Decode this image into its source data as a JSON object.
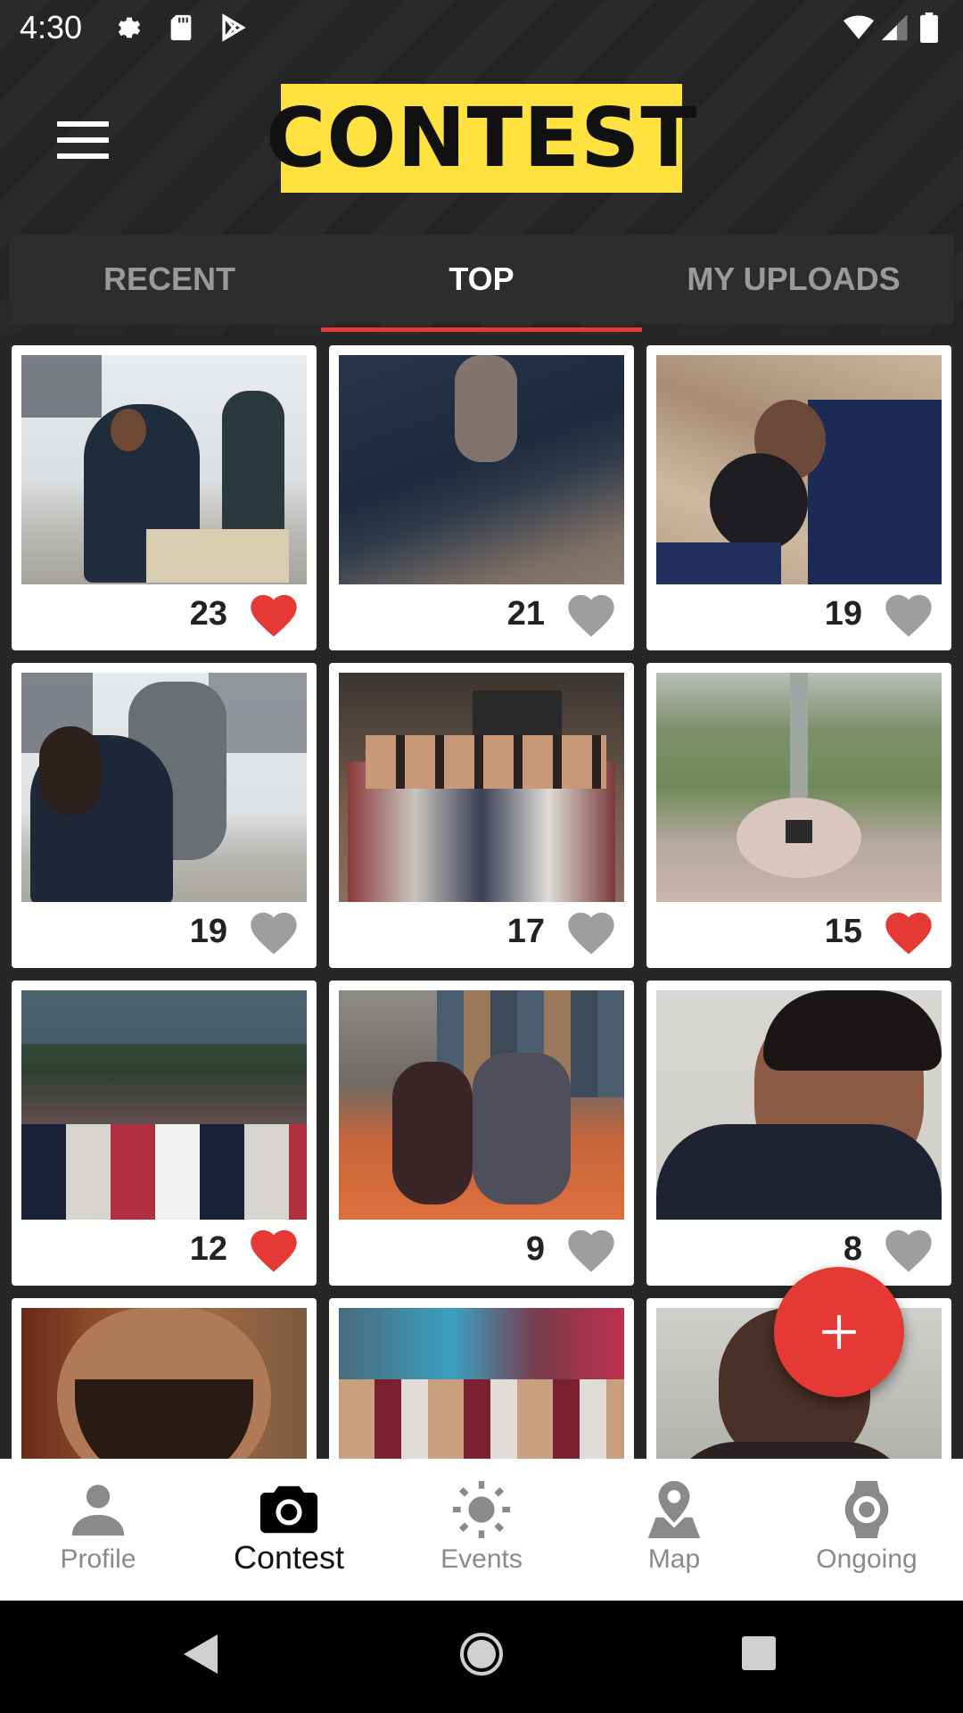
{
  "status_bar": {
    "time": "4:30",
    "icons": [
      "settings-icon",
      "sd-card-icon",
      "play-store-icon",
      "wifi-icon",
      "signal-icon",
      "battery-icon"
    ]
  },
  "header": {
    "title": "CONTEST",
    "title_bg": "#ffe23f",
    "menu_icon": "hamburger-icon"
  },
  "tabs": [
    {
      "label": "RECENT",
      "active": false
    },
    {
      "label": "TOP",
      "active": true
    },
    {
      "label": "MY UPLOADS",
      "active": false
    }
  ],
  "accent_color": "#e53935",
  "posts": [
    {
      "count": "23",
      "liked": true
    },
    {
      "count": "21",
      "liked": false
    },
    {
      "count": "19",
      "liked": false
    },
    {
      "count": "19",
      "liked": false
    },
    {
      "count": "17",
      "liked": false
    },
    {
      "count": "15",
      "liked": true
    },
    {
      "count": "12",
      "liked": true
    },
    {
      "count": "9",
      "liked": false
    },
    {
      "count": "8",
      "liked": false
    },
    {
      "count": "",
      "liked": false
    },
    {
      "count": "",
      "liked": false
    },
    {
      "count": "",
      "liked": false
    }
  ],
  "fab": {
    "icon": "plus-icon"
  },
  "bottom_nav": [
    {
      "label": "Profile",
      "icon": "person-icon",
      "active": false
    },
    {
      "label": "Contest",
      "icon": "camera-icon",
      "active": true
    },
    {
      "label": "Events",
      "icon": "sun-icon",
      "active": false
    },
    {
      "label": "Map",
      "icon": "map-pin-icon",
      "active": false
    },
    {
      "label": "Ongoing",
      "icon": "watch-icon",
      "active": false
    }
  ],
  "system_nav": [
    "back-icon",
    "home-icon",
    "recents-icon"
  ]
}
